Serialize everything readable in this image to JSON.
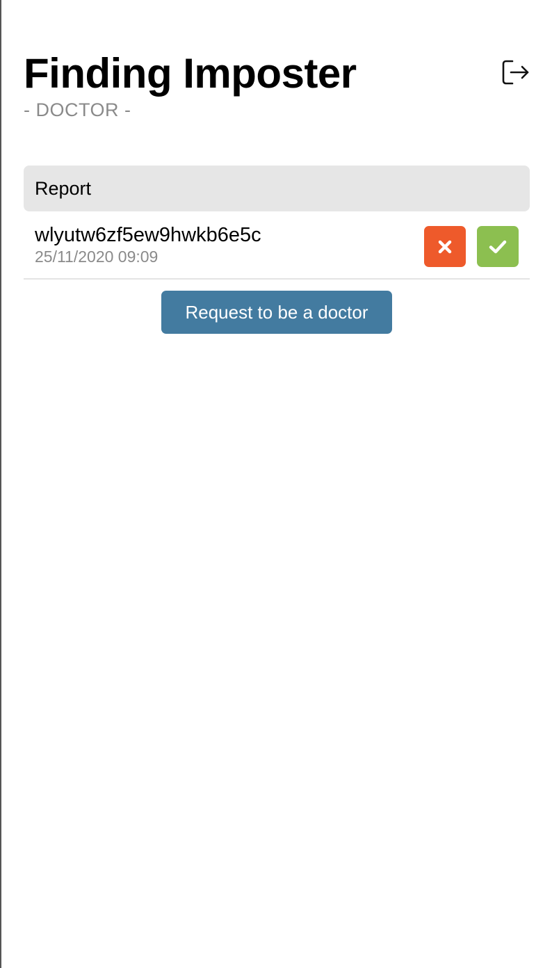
{
  "app": {
    "title": "Finding Imposter",
    "role_label": "- DOCTOR -"
  },
  "header": {
    "logout_icon": "logout-icon"
  },
  "report_section": {
    "header_label": "Report",
    "items": [
      {
        "id": "wlyutw6zf5ew9hwkb6e5c",
        "timestamp": "25/11/2020 09:09",
        "reject_icon": "x-icon",
        "approve_icon": "check-icon"
      }
    ]
  },
  "actions": {
    "request_doctor_label": "Request to be a doctor"
  },
  "colors": {
    "reject": "#ee5a2b",
    "approve": "#8cbf50",
    "primary": "#437ba0",
    "section_bg": "#e6e6e6",
    "muted_text": "#8a8a8a"
  }
}
